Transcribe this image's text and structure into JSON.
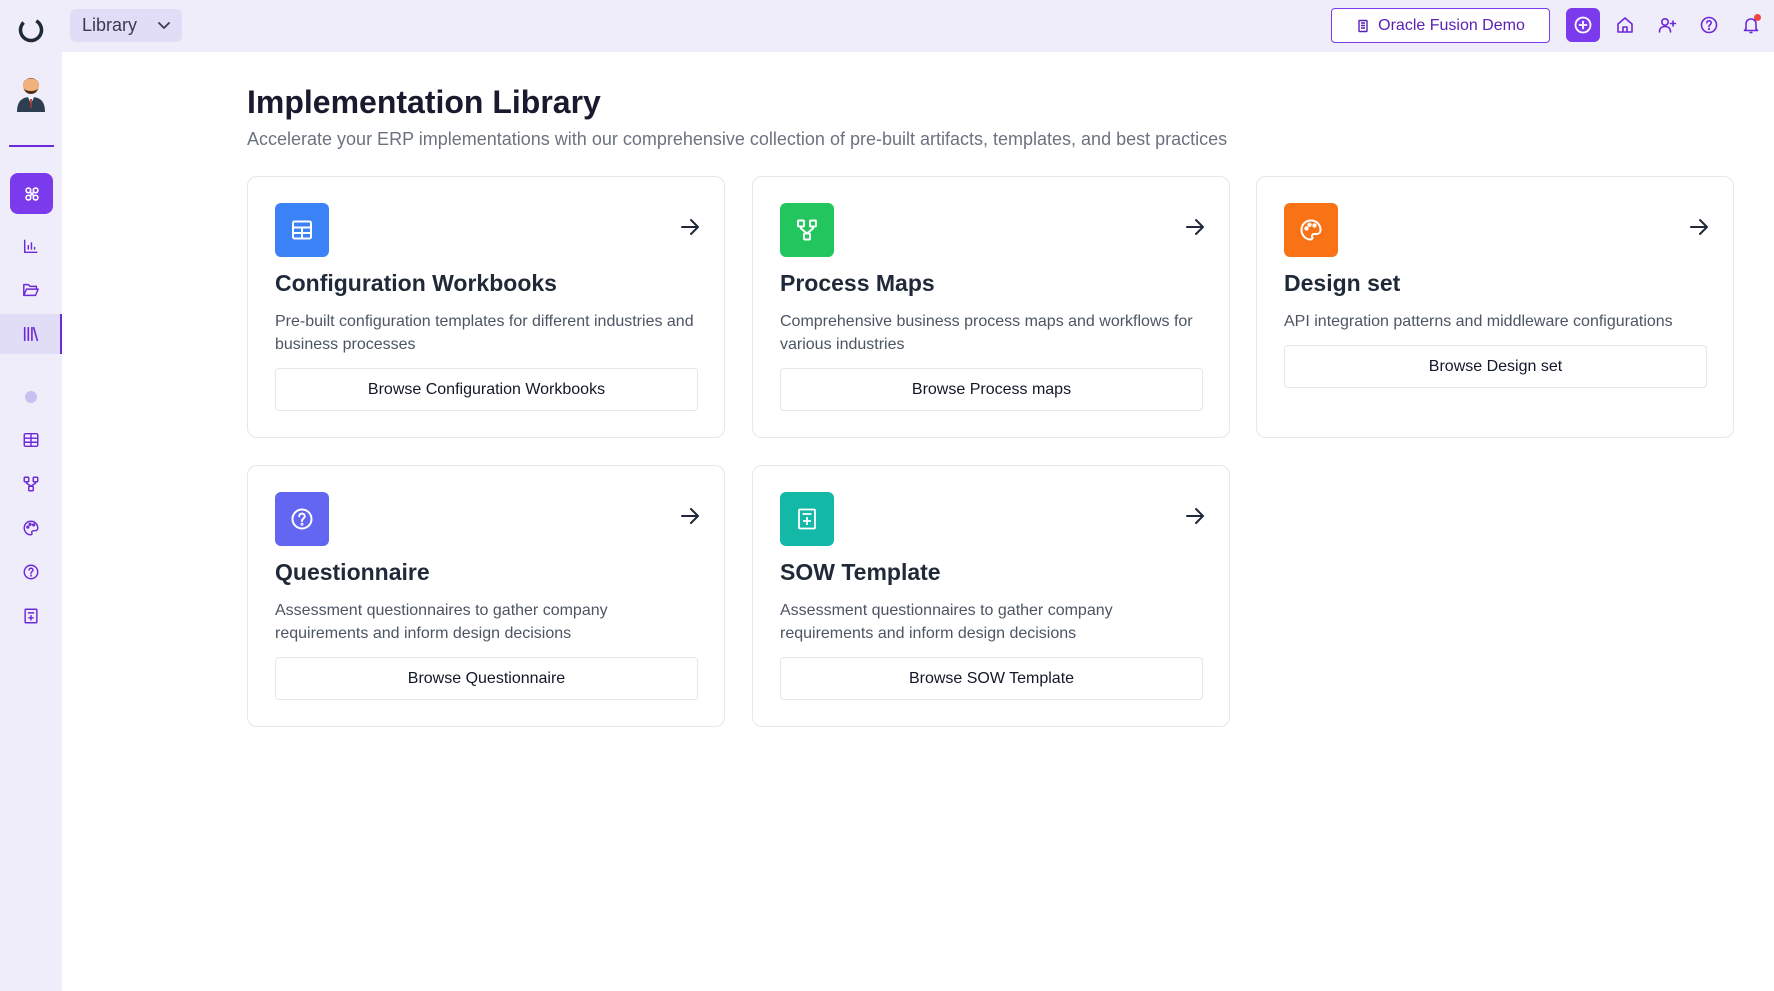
{
  "topbar": {
    "section_select": "Library",
    "project_button": "Oracle Fusion Demo"
  },
  "header": {
    "title": "Implementation Library",
    "subtitle": "Accelerate your ERP implementations with our comprehensive collection of pre-built artifacts, templates, and best practices"
  },
  "cards": [
    {
      "title": "Configuration Workbooks",
      "description": "Pre-built configuration templates for different industries and business processes",
      "button": "Browse Configuration Workbooks",
      "icon": "table-icon",
      "color": "#3b82f6"
    },
    {
      "title": "Process Maps",
      "description": "Comprehensive business process maps and workflows for various industries",
      "button": "Browse Process maps",
      "icon": "workflow-icon",
      "color": "#22c55e"
    },
    {
      "title": "Design set",
      "description": "API integration patterns and middleware configurations",
      "button": "Browse Design set",
      "icon": "palette-icon",
      "color": "#f97316"
    },
    {
      "title": "Questionnaire",
      "description": "Assessment questionnaires to gather company requirements and inform design decisions",
      "button": "Browse Questionnaire",
      "icon": "question-icon",
      "color": "#6366f1"
    },
    {
      "title": "SOW Template",
      "description": "Assessment questionnaires to gather company requirements and inform design decisions",
      "button": "Browse SOW Template",
      "icon": "document-icon",
      "color": "#14b8a6"
    }
  ],
  "colors": {
    "accent": "#7c3aed",
    "sidebar_bg": "#efedf9",
    "notification": "#ef4444"
  }
}
